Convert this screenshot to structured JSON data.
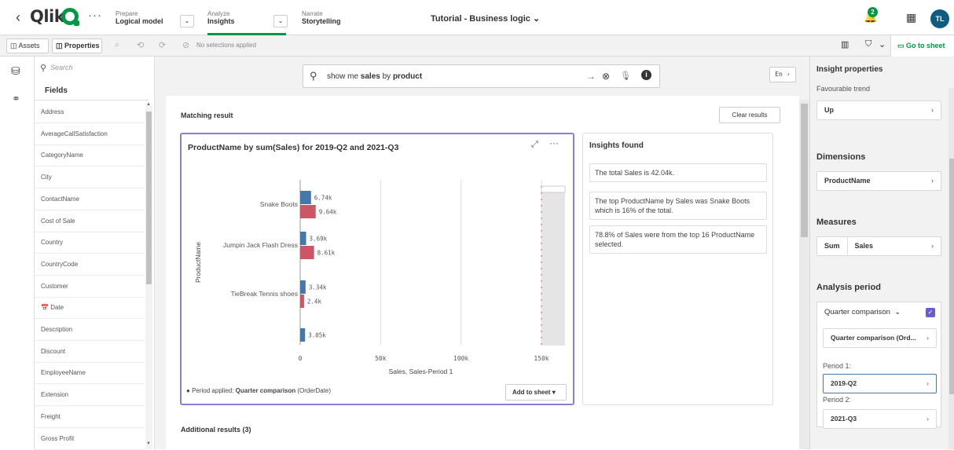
{
  "topbar": {
    "app_name": "Qlik",
    "nav": [
      {
        "sub": "Prepare",
        "main": "Logical model"
      },
      {
        "sub": "Analyze",
        "main": "Insights"
      },
      {
        "sub": "Narrate",
        "main": "Storytelling"
      }
    ],
    "app_title": "Tutorial - Business logic",
    "notification_count": "2",
    "user_initials": "TL"
  },
  "toolbar": {
    "assets_label": "Assets",
    "properties_label": "Properties",
    "no_selections": "No selections applied",
    "goto_sheet": "Go to sheet"
  },
  "fields_panel": {
    "search_placeholder": "Search",
    "tab_label": "Fields",
    "fields": [
      "Address",
      "AverageCallSatisfaction",
      "CategoryName",
      "City",
      "ContactName",
      "Cost of Sale",
      "Country",
      "CountryCode",
      "Customer",
      "Date",
      "Description",
      "Discount",
      "EmployeeName",
      "Extension",
      "Freight",
      "Gross Profit"
    ]
  },
  "query": {
    "prefix": "show me ",
    "bold1": "sales",
    "mid": " by ",
    "bold2": "product"
  },
  "language_button": "En",
  "results": {
    "matching_label": "Matching result",
    "clear_label": "Clear results",
    "additional_label": "Additional results (3)"
  },
  "chart_card": {
    "title": "ProductName by sum(Sales) for 2019-Q2 and 2021-Q3",
    "period_prefix": "Period applied: ",
    "period_bold": "Quarter comparison",
    "period_suffix": " (OrderDate)",
    "add_to_sheet": "Add to sheet"
  },
  "chart_data": {
    "type": "bar",
    "orientation": "horizontal",
    "categories": [
      "Snake Boots",
      "Jumpin Jack Flash Dress",
      "TieBreak Tennis shoes",
      ""
    ],
    "series": [
      {
        "name": "Sales",
        "values": [
          6740,
          3690,
          3340,
          3050
        ],
        "labels": [
          "6.74k",
          "3.69k",
          "3.34k",
          "3.05k"
        ],
        "color": "#4477aa"
      },
      {
        "name": "Sales-Period 1",
        "values": [
          9640,
          8610,
          2400,
          null
        ],
        "labels": [
          "9.64k",
          "8.61k",
          "2.4k",
          ""
        ],
        "color": "#cc5566"
      }
    ],
    "xlabel": "Sales, Sales-Period 1",
    "ylabel": "ProductName",
    "xticks": [
      "0",
      "50k",
      "100k",
      "150k"
    ],
    "xlim": [
      0,
      150000
    ]
  },
  "insights": {
    "title": "Insights found",
    "items": [
      "The total Sales is 42.04k.",
      "The top ProductName by Sales was Snake Boots which is 16% of the total.",
      "78.8% of Sales were from the top 16 ProductName selected."
    ]
  },
  "right_panel": {
    "title": "Insight properties",
    "favourable_trend_label": "Favourable trend",
    "trend_value": "Up",
    "dimensions_label": "Dimensions",
    "dimension_value": "ProductName",
    "measures_label": "Measures",
    "measure_agg": "Sum",
    "measure_value": "Sales",
    "analysis_period_label": "Analysis period",
    "period_type": "Quarter comparison",
    "period_subtype": "Quarter comparison (Ord...",
    "period1_label": "Period 1:",
    "period1_value": "2019-Q2",
    "period2_label": "Period 2:",
    "period2_value": "2021-Q3"
  }
}
